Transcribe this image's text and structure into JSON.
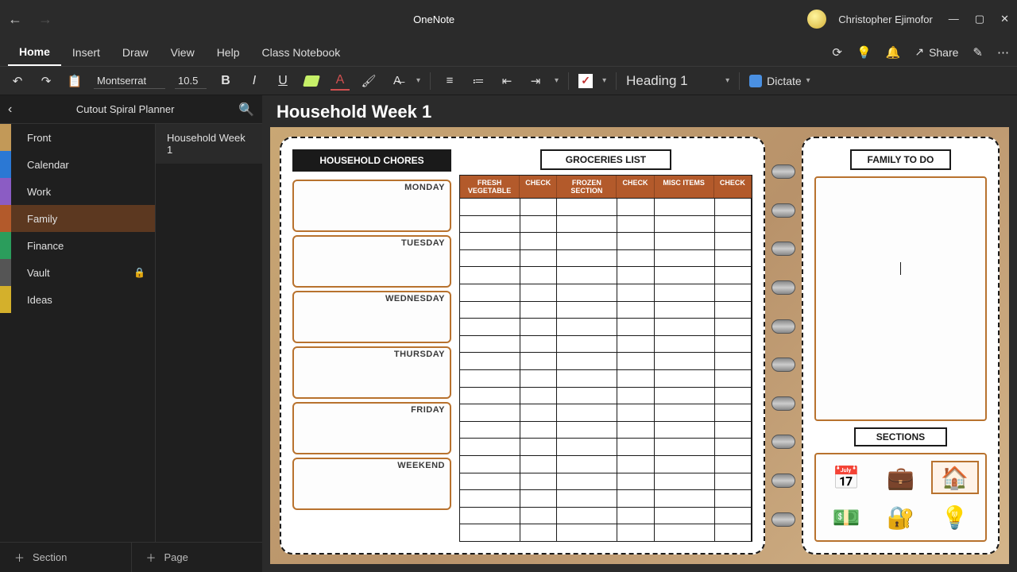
{
  "titlebar": {
    "app_title": "OneNote",
    "user_name": "Christopher Ejimofor"
  },
  "menubar": {
    "tabs": [
      "Home",
      "Insert",
      "Draw",
      "View",
      "Help",
      "Class Notebook"
    ],
    "active_tab": 0,
    "share_label": "Share"
  },
  "ribbon": {
    "font_name": "Montserrat",
    "font_size": "10.5",
    "heading_style": "Heading 1",
    "dictate_label": "Dictate"
  },
  "sidebar": {
    "notebook_title": "Cutout Spiral Planner",
    "sections": [
      {
        "label": "Front",
        "class": "front"
      },
      {
        "label": "Calendar",
        "class": "calendar"
      },
      {
        "label": "Work",
        "class": "work"
      },
      {
        "label": "Family",
        "class": "family"
      },
      {
        "label": "Finance",
        "class": "finance"
      },
      {
        "label": "Vault",
        "class": "vault",
        "locked": true
      },
      {
        "label": "Ideas",
        "class": "ideas"
      }
    ],
    "pages": [
      "Household Week 1"
    ],
    "add_section_label": "Section",
    "add_page_label": "Page"
  },
  "page": {
    "title": "Household Week 1"
  },
  "planner": {
    "chores_header": "HOUSEHOLD CHORES",
    "days": [
      "MONDAY",
      "TUESDAY",
      "WEDNESDAY",
      "THURSDAY",
      "FRIDAY",
      "WEEKEND"
    ],
    "groceries_header": "GROCERIES LIST",
    "groceries_columns": [
      "FRESH VEGETABLE",
      "CHECK",
      "FROZEN SECTION",
      "CHECK",
      "MISC ITEMS",
      "CHECK"
    ],
    "family_header": "FAMILY TO DO",
    "sections_header": "SECTIONS"
  }
}
